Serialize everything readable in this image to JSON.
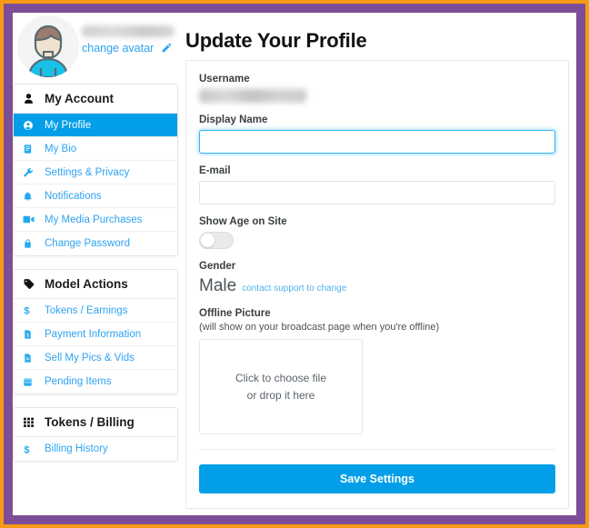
{
  "theme": {
    "outer_border_color": "#f59b14",
    "inner_border_color": "#7d4e97",
    "accent_color": "#029fe8",
    "link_color": "#2ea3f2",
    "page_background": "#ffffff"
  },
  "profile_header": {
    "avatar_icon": "user-avatar-icon",
    "username_masked": "",
    "change_avatar_label": "change avatar",
    "change_avatar_icon": "pencil-icon"
  },
  "sidebar": {
    "groups": [
      {
        "title": "My Account",
        "icon": "person-icon",
        "items": [
          {
            "label": "My Profile",
            "icon": "user-circle-icon",
            "active": true
          },
          {
            "label": "My Bio",
            "icon": "book-icon",
            "active": false
          },
          {
            "label": "Settings & Privacy",
            "icon": "wrench-icon",
            "active": false
          },
          {
            "label": "Notifications",
            "icon": "bell-icon",
            "active": false
          },
          {
            "label": "My Media Purchases",
            "icon": "video-camera-icon",
            "active": false
          },
          {
            "label": "Change Password",
            "icon": "lock-icon",
            "active": false
          }
        ]
      },
      {
        "title": "Model Actions",
        "icon": "tag-icon",
        "items": [
          {
            "label": "Tokens / Earnings",
            "icon": "dollar-icon",
            "active": false
          },
          {
            "label": "Payment Information",
            "icon": "invoice-icon",
            "active": false
          },
          {
            "label": "Sell My Pics & Vids",
            "icon": "document-icon",
            "active": false
          },
          {
            "label": "Pending Items",
            "icon": "calendar-icon",
            "active": false
          }
        ]
      },
      {
        "title": "Tokens / Billing",
        "icon": "grid-icon",
        "items": [
          {
            "label": "Billing History",
            "icon": "dollar-icon",
            "active": false
          }
        ]
      }
    ]
  },
  "main": {
    "title": "Update Your Profile",
    "fields": {
      "username": {
        "label": "Username",
        "value_masked": ""
      },
      "display_name": {
        "label": "Display Name",
        "value": "",
        "placeholder": "",
        "focused": true
      },
      "email": {
        "label": "E-mail",
        "value": "",
        "placeholder": ""
      },
      "show_age": {
        "label": "Show Age on Site",
        "state": "off"
      },
      "gender": {
        "label": "Gender",
        "value": "Male",
        "note": "contact support to change"
      },
      "offline_picture": {
        "label": "Offline Picture",
        "hint": "(will show on your broadcast page when you're offline)",
        "dropzone_line1": "Click to choose file",
        "dropzone_line2": "or drop it here"
      }
    },
    "save_label": "Save Settings"
  }
}
